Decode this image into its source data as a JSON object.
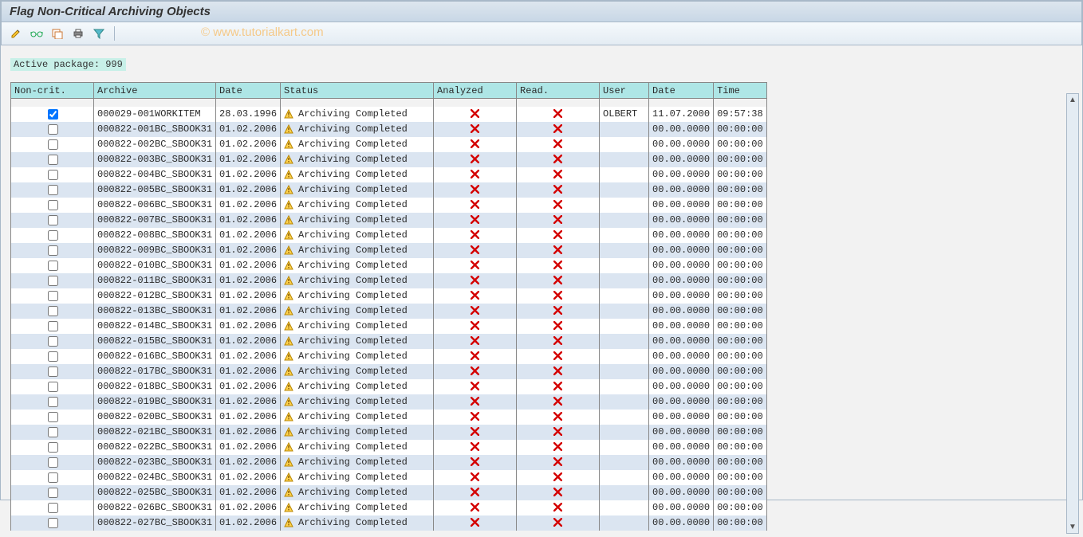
{
  "title": "Flag Non-Critical Archiving Objects",
  "watermark": "© www.tutorialkart.com",
  "active_package_label": "Active package: 999",
  "toolbar": {
    "icons": [
      "pencil-icon",
      "glasses-icon",
      "dropdown-icon",
      "print-icon",
      "filter-icon"
    ]
  },
  "columns": {
    "noncrit": "Non-crit.",
    "archive": "Archive",
    "date1": "Date",
    "status": "Status",
    "analyzed": "Analyzed",
    "read": "Read.",
    "user": "User",
    "date2": "Date",
    "time": "Time"
  },
  "status_text": "Archiving Completed",
  "rows": [
    {
      "checked": true,
      "archive": "000029-001WORKITEM",
      "date1": "28.03.1996",
      "user": "OLBERT",
      "date2": "11.07.2000",
      "time": "09:57:38"
    },
    {
      "checked": false,
      "archive": "000822-001BC_SBOOK31",
      "date1": "01.02.2006",
      "user": "",
      "date2": "00.00.0000",
      "time": "00:00:00"
    },
    {
      "checked": false,
      "archive": "000822-002BC_SBOOK31",
      "date1": "01.02.2006",
      "user": "",
      "date2": "00.00.0000",
      "time": "00:00:00"
    },
    {
      "checked": false,
      "archive": "000822-003BC_SBOOK31",
      "date1": "01.02.2006",
      "user": "",
      "date2": "00.00.0000",
      "time": "00:00:00"
    },
    {
      "checked": false,
      "archive": "000822-004BC_SBOOK31",
      "date1": "01.02.2006",
      "user": "",
      "date2": "00.00.0000",
      "time": "00:00:00"
    },
    {
      "checked": false,
      "archive": "000822-005BC_SBOOK31",
      "date1": "01.02.2006",
      "user": "",
      "date2": "00.00.0000",
      "time": "00:00:00"
    },
    {
      "checked": false,
      "archive": "000822-006BC_SBOOK31",
      "date1": "01.02.2006",
      "user": "",
      "date2": "00.00.0000",
      "time": "00:00:00"
    },
    {
      "checked": false,
      "archive": "000822-007BC_SBOOK31",
      "date1": "01.02.2006",
      "user": "",
      "date2": "00.00.0000",
      "time": "00:00:00"
    },
    {
      "checked": false,
      "archive": "000822-008BC_SBOOK31",
      "date1": "01.02.2006",
      "user": "",
      "date2": "00.00.0000",
      "time": "00:00:00"
    },
    {
      "checked": false,
      "archive": "000822-009BC_SBOOK31",
      "date1": "01.02.2006",
      "user": "",
      "date2": "00.00.0000",
      "time": "00:00:00"
    },
    {
      "checked": false,
      "archive": "000822-010BC_SBOOK31",
      "date1": "01.02.2006",
      "user": "",
      "date2": "00.00.0000",
      "time": "00:00:00"
    },
    {
      "checked": false,
      "archive": "000822-011BC_SBOOK31",
      "date1": "01.02.2006",
      "user": "",
      "date2": "00.00.0000",
      "time": "00:00:00"
    },
    {
      "checked": false,
      "archive": "000822-012BC_SBOOK31",
      "date1": "01.02.2006",
      "user": "",
      "date2": "00.00.0000",
      "time": "00:00:00"
    },
    {
      "checked": false,
      "archive": "000822-013BC_SBOOK31",
      "date1": "01.02.2006",
      "user": "",
      "date2": "00.00.0000",
      "time": "00:00:00"
    },
    {
      "checked": false,
      "archive": "000822-014BC_SBOOK31",
      "date1": "01.02.2006",
      "user": "",
      "date2": "00.00.0000",
      "time": "00:00:00"
    },
    {
      "checked": false,
      "archive": "000822-015BC_SBOOK31",
      "date1": "01.02.2006",
      "user": "",
      "date2": "00.00.0000",
      "time": "00:00:00"
    },
    {
      "checked": false,
      "archive": "000822-016BC_SBOOK31",
      "date1": "01.02.2006",
      "user": "",
      "date2": "00.00.0000",
      "time": "00:00:00"
    },
    {
      "checked": false,
      "archive": "000822-017BC_SBOOK31",
      "date1": "01.02.2006",
      "user": "",
      "date2": "00.00.0000",
      "time": "00:00:00"
    },
    {
      "checked": false,
      "archive": "000822-018BC_SBOOK31",
      "date1": "01.02.2006",
      "user": "",
      "date2": "00.00.0000",
      "time": "00:00:00"
    },
    {
      "checked": false,
      "archive": "000822-019BC_SBOOK31",
      "date1": "01.02.2006",
      "user": "",
      "date2": "00.00.0000",
      "time": "00:00:00"
    },
    {
      "checked": false,
      "archive": "000822-020BC_SBOOK31",
      "date1": "01.02.2006",
      "user": "",
      "date2": "00.00.0000",
      "time": "00:00:00"
    },
    {
      "checked": false,
      "archive": "000822-021BC_SBOOK31",
      "date1": "01.02.2006",
      "user": "",
      "date2": "00.00.0000",
      "time": "00:00:00"
    },
    {
      "checked": false,
      "archive": "000822-022BC_SBOOK31",
      "date1": "01.02.2006",
      "user": "",
      "date2": "00.00.0000",
      "time": "00:00:00"
    },
    {
      "checked": false,
      "archive": "000822-023BC_SBOOK31",
      "date1": "01.02.2006",
      "user": "",
      "date2": "00.00.0000",
      "time": "00:00:00"
    },
    {
      "checked": false,
      "archive": "000822-024BC_SBOOK31",
      "date1": "01.02.2006",
      "user": "",
      "date2": "00.00.0000",
      "time": "00:00:00"
    },
    {
      "checked": false,
      "archive": "000822-025BC_SBOOK31",
      "date1": "01.02.2006",
      "user": "",
      "date2": "00.00.0000",
      "time": "00:00:00"
    },
    {
      "checked": false,
      "archive": "000822-026BC_SBOOK31",
      "date1": "01.02.2006",
      "user": "",
      "date2": "00.00.0000",
      "time": "00:00:00"
    },
    {
      "checked": false,
      "archive": "000822-027BC_SBOOK31",
      "date1": "01.02.2006",
      "user": "",
      "date2": "00.00.0000",
      "time": "00:00:00"
    }
  ]
}
